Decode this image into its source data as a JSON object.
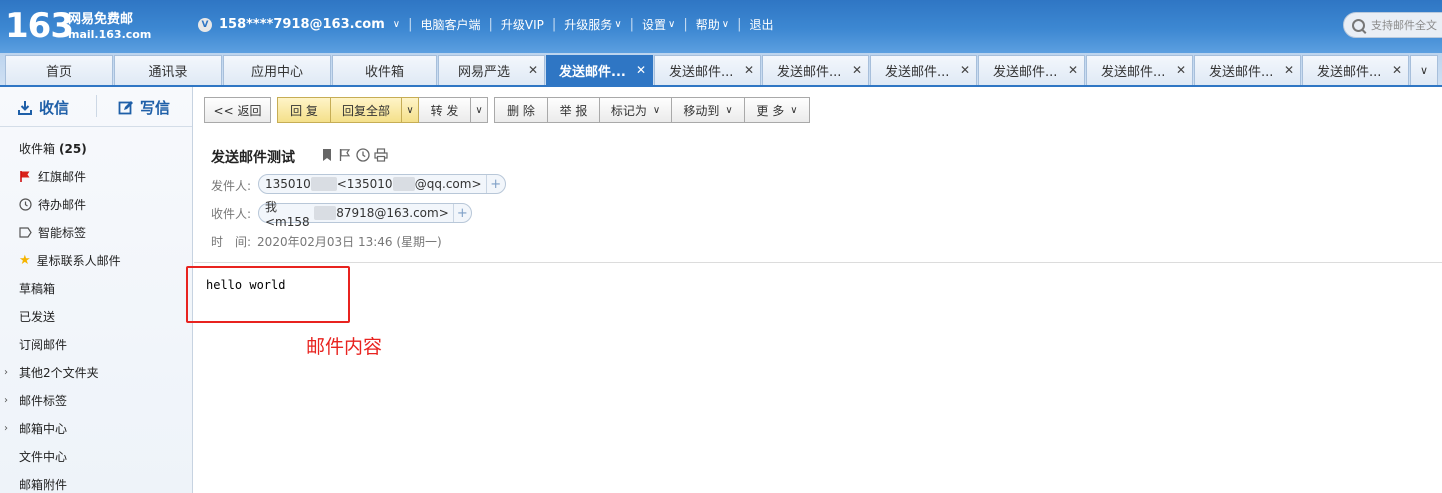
{
  "brand": {
    "number": "163",
    "name": "网易免费邮",
    "domain": "mail.163.com"
  },
  "user": {
    "vip_letter": "V",
    "email": "158****7918@163.com"
  },
  "topnav": [
    "电脑客户端",
    "升级VIP",
    "升级服务",
    "设置",
    "帮助",
    "退出"
  ],
  "search": {
    "placeholder": "支持邮件全文"
  },
  "tabs": [
    {
      "label": "首页"
    },
    {
      "label": "通讯录"
    },
    {
      "label": "应用中心"
    },
    {
      "label": "收件箱"
    },
    {
      "label": "网易严选"
    },
    {
      "label": "发送邮件..."
    },
    {
      "label": "发送邮件..."
    },
    {
      "label": "发送邮件..."
    },
    {
      "label": "发送邮件..."
    },
    {
      "label": "发送邮件..."
    },
    {
      "label": "发送邮件..."
    },
    {
      "label": "发送邮件..."
    },
    {
      "label": "发送邮件..."
    }
  ],
  "sidebar": {
    "receive": "收信",
    "compose": "写信",
    "folders": [
      {
        "label": "收件箱",
        "count": "(25)"
      },
      {
        "label": "红旗邮件"
      },
      {
        "label": "待办邮件"
      },
      {
        "label": "智能标签"
      },
      {
        "label": "星标联系人邮件"
      },
      {
        "label": "草稿箱"
      },
      {
        "label": "已发送"
      },
      {
        "label": "订阅邮件"
      },
      {
        "label": "其他2个文件夹"
      },
      {
        "label": "邮件标签"
      },
      {
        "label": "邮箱中心"
      },
      {
        "label": "文件中心"
      },
      {
        "label": "邮箱附件"
      }
    ]
  },
  "toolbar": {
    "back": "<< 返回",
    "reply": "回 复",
    "reply_all": "回复全部",
    "forward": "转 发",
    "delete": "删 除",
    "report": "举 报",
    "mark_as": "标记为",
    "move_to": "移动到",
    "more": "更 多"
  },
  "message": {
    "subject": "发送邮件测试",
    "from_label": "发件人:",
    "from_a": "135010",
    "from_b": "<135010",
    "from_c": "@qq.com>",
    "to_label": "收件人:",
    "to_a": "我<m158",
    "to_b": "87918@163.com>",
    "time_label": "时　间:",
    "time_value": "2020年02月03日 13:46 (星期一)",
    "body": "hello world"
  },
  "annotation": {
    "text": "邮件内容",
    "color": "#e8231f"
  },
  "colors": {
    "brand_blue": "#2f76c4",
    "reply_yellow": "#f4e08a"
  }
}
